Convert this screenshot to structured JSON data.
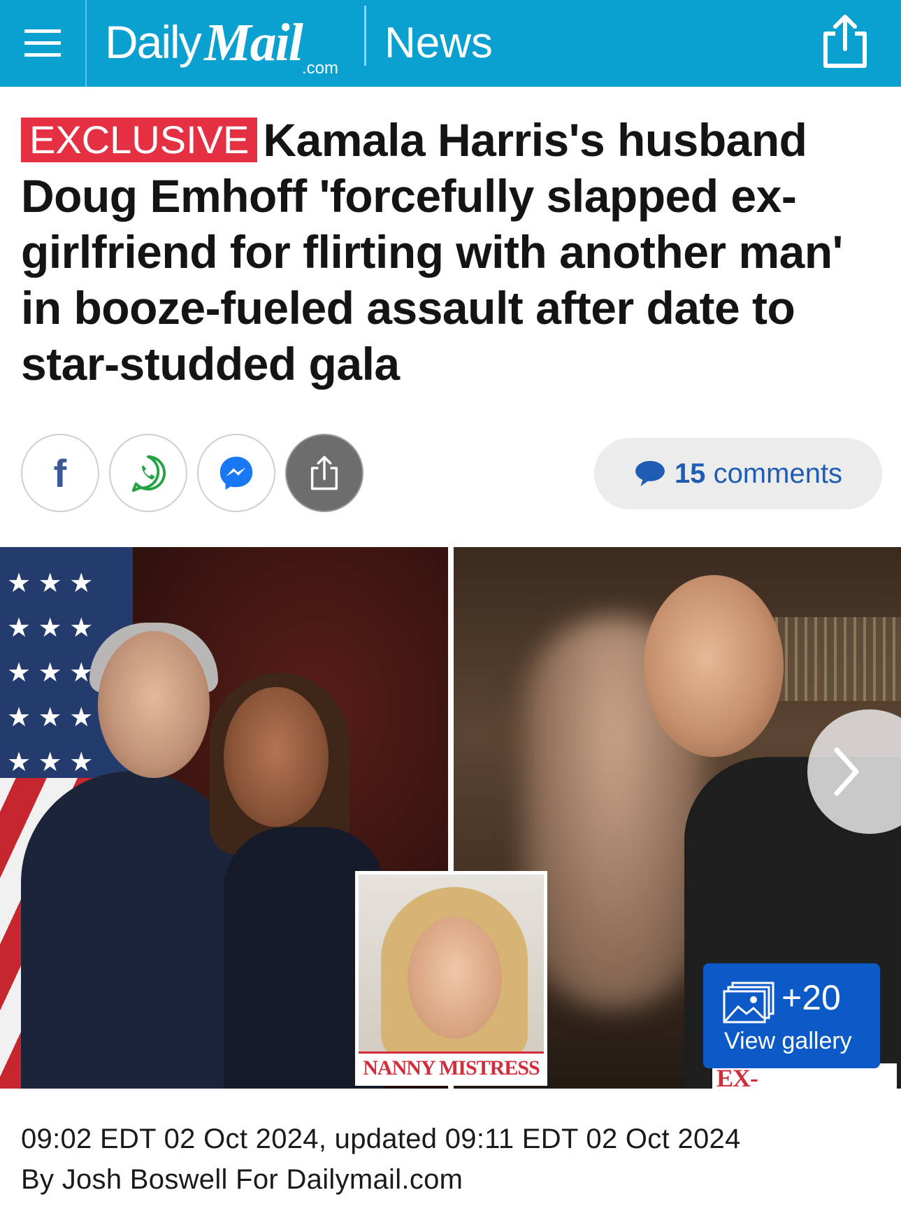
{
  "header": {
    "logo_daily": "Daily",
    "logo_mail": "Mail",
    "logo_com": ".com",
    "section": "News",
    "brand_color": "#0aa0d0"
  },
  "article": {
    "badge": "EXCLUSIVE",
    "headline": "Kamala Harris's husband Doug Emhoff 'forcefully slapped ex-girlfriend for flirting with another man' in booze-fueled assault after date to star-studded gala",
    "badge_color": "#e53043"
  },
  "share": {
    "facebook_icon": "facebook-icon",
    "whatsapp_icon": "whatsapp-icon",
    "messenger_icon": "messenger-icon",
    "share_icon": "share-icon",
    "comments_count": "15",
    "comments_label": "comments"
  },
  "hero": {
    "inset_caption": "NANNY MISTRESS",
    "right_caption": "EX-GIRLFRIEND",
    "gallery_count": "+20",
    "gallery_label": "View gallery"
  },
  "meta": {
    "timestamp": "09:02 EDT 02 Oct 2024, updated 09:11 EDT 02 Oct 2024",
    "byline": "By Josh Boswell For Dailymail.com"
  }
}
